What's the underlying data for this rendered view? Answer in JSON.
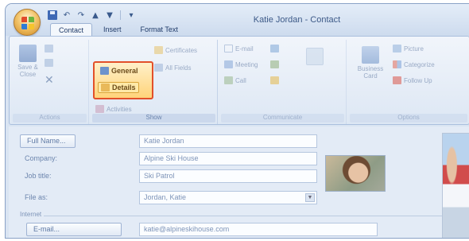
{
  "window": {
    "title": "Katie Jordan - Contact"
  },
  "tabs": [
    {
      "label": "Contact",
      "active": true
    },
    {
      "label": "Insert",
      "active": false
    },
    {
      "label": "Format Text",
      "active": false
    }
  ],
  "ribbon": {
    "actions": {
      "save_close": "Save & Close",
      "group_label": "Actions"
    },
    "show": {
      "general": "General",
      "details": "Details",
      "certificates": "Certificates",
      "all_fields": "All Fields",
      "activities": "Activities",
      "group_label": "Show"
    },
    "communicate": {
      "email": "E-mail",
      "meeting": "Meeting",
      "call": "Call",
      "group_label": "Communicate"
    },
    "options": {
      "business_card": "Business Card",
      "picture": "Picture",
      "categorize": "Categorize",
      "follow_up": "Follow Up",
      "group_label": "Options"
    }
  },
  "form": {
    "full_name_button": "Full Name...",
    "full_name_value": "Katie Jordan",
    "company_label": "Company:",
    "company_value": "Alpine Ski House",
    "job_title_label": "Job title:",
    "job_title_value": "Ski Patrol",
    "file_as_label": "File as:",
    "file_as_value": "Jordan, Katie",
    "internet_label": "Internet",
    "email_button": "E-mail...",
    "email_value": "katie@alpineskihouse.com"
  },
  "colors": {
    "highlight": "#e2502a",
    "ribbon_bg": "#dde7f4",
    "title_text": "#3d5a88"
  }
}
